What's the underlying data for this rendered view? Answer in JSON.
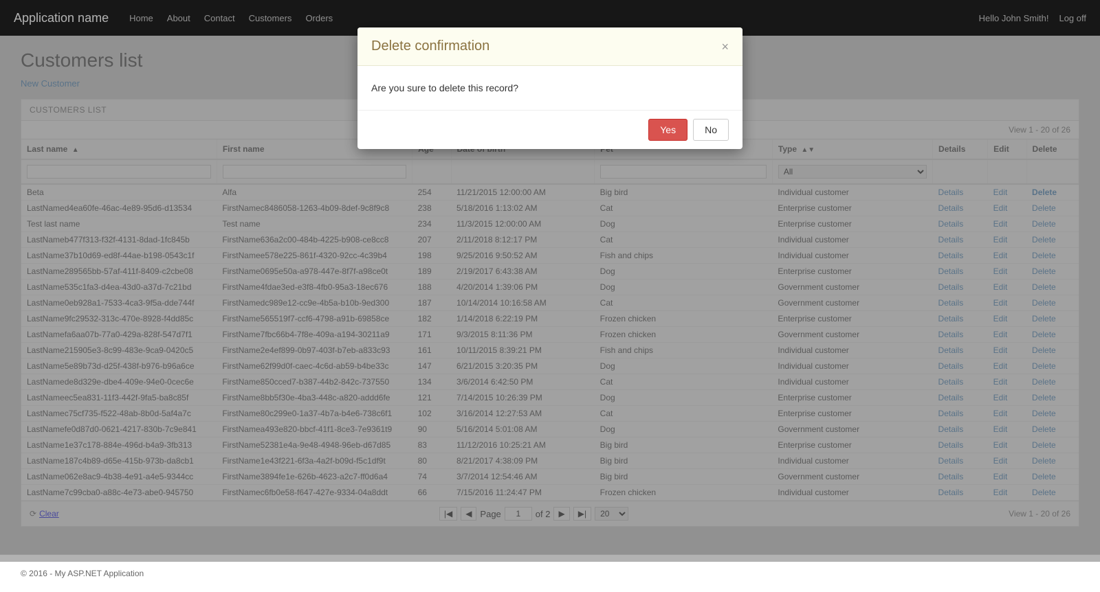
{
  "app": {
    "name": "Application name",
    "nav_links": [
      "Home",
      "About",
      "Contact",
      "Customers",
      "Orders"
    ],
    "greeting": "Hello John Smith!",
    "logoff": "Log off"
  },
  "page": {
    "title": "Customers list",
    "new_customer": "New Customer",
    "table_section": "CUSTOMERS LIST"
  },
  "modal": {
    "title": "Delete confirmation",
    "body": "Are you sure to delete this record?",
    "yes_label": "Yes",
    "no_label": "No",
    "close_symbol": "×"
  },
  "table": {
    "view_text": "View 1 - 20 of 26",
    "columns": [
      "Last name",
      "First name",
      "Age",
      "Date of birth",
      "Pet",
      "Type",
      "Details",
      "Edit",
      "Delete"
    ],
    "rows": [
      [
        "Beta",
        "Alfa",
        "254",
        "11/21/2015 12:00:00 AM",
        "Big bird",
        "Individual customer",
        "Details",
        "Edit",
        "Delete"
      ],
      [
        "LastNamed4ea60fe-46ac-4e89-95d6-d13534",
        "FirstNamec8486058-1263-4b09-8def-9c8f9c8",
        "238",
        "5/18/2016 1:13:02 AM",
        "Cat",
        "Enterprise customer",
        "Details",
        "Edit",
        "Delete"
      ],
      [
        "Test last name",
        "Test name",
        "234",
        "11/3/2015 12:00:00 AM",
        "Dog",
        "Enterprise customer",
        "Details",
        "Edit",
        "Delete"
      ],
      [
        "LastNameb477f313-f32f-4131-8dad-1fc845b",
        "FirstName636a2c00-484b-4225-b908-ce8cc8",
        "207",
        "2/11/2018 8:12:17 PM",
        "Cat",
        "Individual customer",
        "Details",
        "Edit",
        "Delete"
      ],
      [
        "LastName37b10d69-ed8f-44ae-b198-0543c1f",
        "FirstNamee578e225-861f-4320-92cc-4c39b4",
        "198",
        "9/25/2016 9:50:52 AM",
        "Fish and chips",
        "Individual customer",
        "Details",
        "Edit",
        "Delete"
      ],
      [
        "LastName289565bb-57af-411f-8409-c2cbe08",
        "FirstName0695e50a-a978-447e-8f7f-a98ce0t",
        "189",
        "2/19/2017 6:43:38 AM",
        "Dog",
        "Enterprise customer",
        "Details",
        "Edit",
        "Delete"
      ],
      [
        "LastName535c1fa3-d4ea-43d0-a37d-7c21bd",
        "FirstName4fdae3ed-e3f8-4fb0-95a3-18ec676",
        "188",
        "4/20/2014 1:39:06 PM",
        "Dog",
        "Government customer",
        "Details",
        "Edit",
        "Delete"
      ],
      [
        "LastName0eb928a1-7533-4ca3-9f5a-dde744f",
        "FirstNamedc989e12-cc9e-4b5a-b10b-9ed300",
        "187",
        "10/14/2014 10:16:58 AM",
        "Cat",
        "Government customer",
        "Details",
        "Edit",
        "Delete"
      ],
      [
        "LastName9fc29532-313c-470e-8928-f4dd85c",
        "FirstName565519f7-ccf6-4798-a91b-69858ce",
        "182",
        "1/14/2018 6:22:19 PM",
        "Frozen chicken",
        "Enterprise customer",
        "Details",
        "Edit",
        "Delete"
      ],
      [
        "LastNamefa6aa07b-77a0-429a-828f-547d7f1",
        "FirstName7fbc66b4-7f8e-409a-a194-30211a9",
        "171",
        "9/3/2015 8:11:36 PM",
        "Frozen chicken",
        "Government customer",
        "Details",
        "Edit",
        "Delete"
      ],
      [
        "LastName215905e3-8c99-483e-9ca9-0420c5",
        "FirstName2e4ef899-0b97-403f-b7eb-a833c93",
        "161",
        "10/11/2015 8:39:21 PM",
        "Fish and chips",
        "Individual customer",
        "Details",
        "Edit",
        "Delete"
      ],
      [
        "LastName5e89b73d-d25f-438f-b976-b96a6ce",
        "FirstName62f99d0f-caec-4c6d-ab59-b4be33c",
        "147",
        "6/21/2015 3:20:35 PM",
        "Dog",
        "Individual customer",
        "Details",
        "Edit",
        "Delete"
      ],
      [
        "LastNamede8d329e-dbe4-409e-94e0-0cec6e",
        "FirstName850cced7-b387-44b2-842c-737550",
        "134",
        "3/6/2014 6:42:50 PM",
        "Cat",
        "Individual customer",
        "Details",
        "Edit",
        "Delete"
      ],
      [
        "LastNameec5ea831-11f3-442f-9fa5-ba8c85f",
        "FirstName8bb5f30e-4ba3-448c-a820-addd6fe",
        "121",
        "7/14/2015 10:26:39 PM",
        "Dog",
        "Enterprise customer",
        "Details",
        "Edit",
        "Delete"
      ],
      [
        "LastNamec75cf735-f522-48ab-8b0d-5af4a7c",
        "FirstName80c299e0-1a37-4b7a-b4e6-738c6f1",
        "102",
        "3/16/2014 12:27:53 AM",
        "Cat",
        "Enterprise customer",
        "Details",
        "Edit",
        "Delete"
      ],
      [
        "LastNamefe0d87d0-0621-4217-830b-7c9e841",
        "FirstNamea493e820-bbcf-41f1-8ce3-7e9361t9",
        "90",
        "5/16/2014 5:01:08 AM",
        "Dog",
        "Government customer",
        "Details",
        "Edit",
        "Delete"
      ],
      [
        "LastName1e37c178-884e-496d-b4a9-3fb313",
        "FirstName52381e4a-9e48-4948-96eb-d67d85",
        "83",
        "11/12/2016 10:25:21 AM",
        "Big bird",
        "Enterprise customer",
        "Details",
        "Edit",
        "Delete"
      ],
      [
        "LastName187c4b89-d65e-415b-973b-da8cb1",
        "FirstName1e43f221-6f3a-4a2f-b09d-f5c1df9t",
        "80",
        "8/21/2017 4:38:09 PM",
        "Big bird",
        "Individual customer",
        "Details",
        "Edit",
        "Delete"
      ],
      [
        "LastName062e8ac9-4b38-4e91-a4e5-9344cc",
        "FirstName3894fe1e-626b-4623-a2c7-ff0d6a4",
        "74",
        "3/7/2014 12:54:46 AM",
        "Big bird",
        "Government customer",
        "Details",
        "Edit",
        "Delete"
      ],
      [
        "LastName7c99cba0-a88c-4e73-abe0-945750",
        "FirstNamec6fb0e58-f647-427e-9334-04a8ddt",
        "66",
        "7/15/2016 11:24:47 PM",
        "Frozen chicken",
        "Individual customer",
        "Details",
        "Edit",
        "Delete"
      ]
    ]
  },
  "pagination": {
    "clear_label": "Clear",
    "page_label": "Page",
    "of_label": "of 2",
    "page_value": "1",
    "per_page": "20",
    "view_text": "View 1 - 20 of 26"
  },
  "footer": {
    "text": "© 2016 - My ASP.NET Application"
  }
}
